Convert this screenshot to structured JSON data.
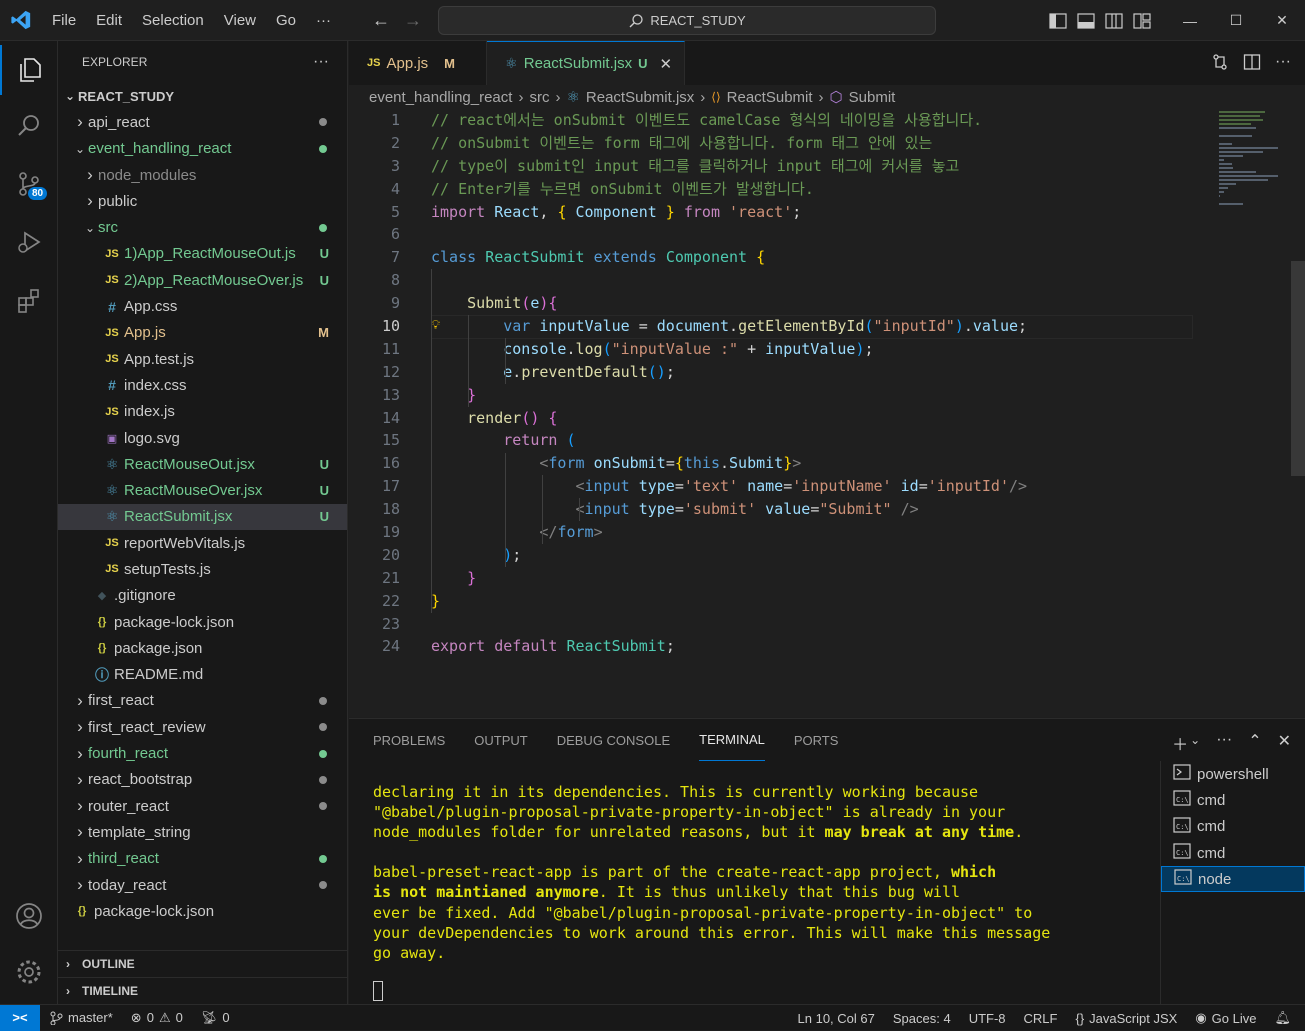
{
  "menu": [
    "File",
    "Edit",
    "Selection",
    "View",
    "Go",
    "···"
  ],
  "search": {
    "text": "REACT_STUDY"
  },
  "activity": {
    "badge": "80"
  },
  "explorer": {
    "title": "EXPLORER",
    "root": "REACT_STUDY",
    "rows": [
      {
        "label": "api_react",
        "type": "folder",
        "indent": 1,
        "open": false,
        "color": "#cccccc",
        "dot": "#8b8b8b"
      },
      {
        "label": "event_handling_react",
        "type": "folder",
        "indent": 1,
        "open": true,
        "color": "#73c991",
        "dot": "#73c991"
      },
      {
        "label": "node_modules",
        "type": "folder",
        "indent": 2,
        "open": false,
        "color": "#8b8b8b"
      },
      {
        "label": "public",
        "type": "folder",
        "indent": 2,
        "open": false,
        "color": "#cccccc"
      },
      {
        "label": "src",
        "type": "folder",
        "indent": 2,
        "open": true,
        "color": "#73c991",
        "dot": "#73c991"
      },
      {
        "label": "1)App_ReactMouseOut.js",
        "type": "js",
        "indent": 3,
        "color": "#73c991",
        "status": "U",
        "statusColor": "#73c991"
      },
      {
        "label": "2)App_ReactMouseOver.js",
        "type": "js",
        "indent": 3,
        "color": "#73c991",
        "status": "U",
        "statusColor": "#73c991"
      },
      {
        "label": "App.css",
        "type": "css",
        "indent": 3,
        "color": "#cccccc"
      },
      {
        "label": "App.js",
        "type": "js",
        "indent": 3,
        "color": "#e2c08d",
        "status": "M",
        "statusColor": "#e2c08d"
      },
      {
        "label": "App.test.js",
        "type": "js",
        "indent": 3,
        "color": "#cccccc"
      },
      {
        "label": "index.css",
        "type": "css",
        "indent": 3,
        "color": "#cccccc"
      },
      {
        "label": "index.js",
        "type": "js",
        "indent": 3,
        "color": "#cccccc"
      },
      {
        "label": "logo.svg",
        "type": "svg",
        "indent": 3,
        "color": "#cccccc"
      },
      {
        "label": "ReactMouseOut.jsx",
        "type": "jsx",
        "indent": 3,
        "color": "#73c991",
        "status": "U",
        "statusColor": "#73c991"
      },
      {
        "label": "ReactMouseOver.jsx",
        "type": "jsx",
        "indent": 3,
        "color": "#73c991",
        "status": "U",
        "statusColor": "#73c991"
      },
      {
        "label": "ReactSubmit.jsx",
        "type": "jsx",
        "indent": 3,
        "color": "#73c991",
        "status": "U",
        "statusColor": "#73c991",
        "selected": true
      },
      {
        "label": "reportWebVitals.js",
        "type": "js",
        "indent": 3,
        "color": "#cccccc"
      },
      {
        "label": "setupTests.js",
        "type": "js",
        "indent": 3,
        "color": "#cccccc"
      },
      {
        "label": ".gitignore",
        "type": "git",
        "indent": 2,
        "color": "#cccccc"
      },
      {
        "label": "package-lock.json",
        "type": "json",
        "indent": 2,
        "color": "#cccccc"
      },
      {
        "label": "package.json",
        "type": "json",
        "indent": 2,
        "color": "#cccccc"
      },
      {
        "label": "README.md",
        "type": "info",
        "indent": 2,
        "color": "#cccccc"
      },
      {
        "label": "first_react",
        "type": "folder",
        "indent": 1,
        "open": false,
        "color": "#cccccc",
        "dot": "#8b8b8b"
      },
      {
        "label": "first_react_review",
        "type": "folder",
        "indent": 1,
        "open": false,
        "color": "#cccccc",
        "dot": "#8b8b8b"
      },
      {
        "label": "fourth_react",
        "type": "folder",
        "indent": 1,
        "open": false,
        "color": "#73c991",
        "dot": "#73c991"
      },
      {
        "label": "react_bootstrap",
        "type": "folder",
        "indent": 1,
        "open": false,
        "color": "#cccccc",
        "dot": "#8b8b8b"
      },
      {
        "label": "router_react",
        "type": "folder",
        "indent": 1,
        "open": false,
        "color": "#cccccc",
        "dot": "#8b8b8b"
      },
      {
        "label": "template_string",
        "type": "folder",
        "indent": 1,
        "open": false,
        "color": "#cccccc"
      },
      {
        "label": "third_react",
        "type": "folder",
        "indent": 1,
        "open": false,
        "color": "#73c991",
        "dot": "#73c991"
      },
      {
        "label": "today_react",
        "type": "folder",
        "indent": 1,
        "open": false,
        "color": "#cccccc",
        "dot": "#8b8b8b"
      },
      {
        "label": "package-lock.json",
        "type": "json",
        "indent": 0,
        "color": "#cccccc"
      }
    ],
    "outline": "OUTLINE",
    "timeline": "TIMELINE"
  },
  "tabs": [
    {
      "icon": "JS",
      "label": "App.js",
      "status": "M",
      "active": false
    },
    {
      "icon": "⚛",
      "label": "ReactSubmit.jsx",
      "status": "U",
      "active": true
    }
  ],
  "breadcrumb": [
    "event_handling_react",
    "src",
    "ReactSubmit.jsx",
    "ReactSubmit",
    "Submit"
  ],
  "code": [
    [
      [
        "cm",
        "// react에서는 onSubmit 이벤트도 camelCase 형식의 네이밍을 사용합니다."
      ]
    ],
    [
      [
        "cm",
        "// onSubmit 이벤트는 form 태그에 사용합니다. form 태그 안에 있는"
      ]
    ],
    [
      [
        "cm",
        "// type이 submit인 input 태그를 클릭하거나 input 태그에 커서를 놓고"
      ]
    ],
    [
      [
        "cm",
        "// Enter키를 누르면 onSubmit 이벤트가 발생합니다."
      ]
    ],
    [
      [
        "kw2",
        "import "
      ],
      [
        "var",
        "React"
      ],
      [
        "pl",
        ", "
      ],
      [
        "br1",
        "{ "
      ],
      [
        "var",
        "Component"
      ],
      [
        "br1",
        " }"
      ],
      [
        "kw2",
        " from "
      ],
      [
        "str",
        "'react'"
      ],
      [
        "pl",
        ";"
      ]
    ],
    [],
    [
      [
        "kw",
        "class "
      ],
      [
        "cls",
        "ReactSubmit "
      ],
      [
        "kw",
        "extends "
      ],
      [
        "cls",
        "Component "
      ],
      [
        "br1",
        "{"
      ]
    ],
    [],
    [
      [
        "pl",
        "    "
      ],
      [
        "fn",
        "Submit"
      ],
      [
        "br2",
        "("
      ],
      [
        "var",
        "e"
      ],
      [
        "br2",
        ")"
      ],
      [
        "br2",
        "{"
      ]
    ],
    [
      [
        "pl",
        "        "
      ],
      [
        "kw",
        "var "
      ],
      [
        "var",
        "inputValue "
      ],
      [
        "pl",
        "= "
      ],
      [
        "var",
        "document"
      ],
      [
        "pl",
        "."
      ],
      [
        "fn",
        "getElementById"
      ],
      [
        "br3",
        "("
      ],
      [
        "str",
        "\"inputId\""
      ],
      [
        "br3",
        ")"
      ],
      [
        "pl",
        "."
      ],
      [
        "var",
        "value"
      ],
      [
        "pl",
        ";"
      ]
    ],
    [
      [
        "pl",
        "        "
      ],
      [
        "var",
        "console"
      ],
      [
        "pl",
        "."
      ],
      [
        "fn",
        "log"
      ],
      [
        "br3",
        "("
      ],
      [
        "str",
        "\"inputValue :\""
      ],
      [
        "pl",
        " + "
      ],
      [
        "var",
        "inputValue"
      ],
      [
        "br3",
        ")"
      ],
      [
        "pl",
        ";"
      ]
    ],
    [
      [
        "pl",
        "        "
      ],
      [
        "var",
        "e"
      ],
      [
        "pl",
        "."
      ],
      [
        "fn",
        "preventDefault"
      ],
      [
        "br3",
        "()"
      ],
      [
        "pl",
        ";"
      ]
    ],
    [
      [
        "pl",
        "    "
      ],
      [
        "br2",
        "}"
      ]
    ],
    [
      [
        "pl",
        "    "
      ],
      [
        "fn",
        "render"
      ],
      [
        "br2",
        "()"
      ],
      [
        "pl",
        " "
      ],
      [
        "br2",
        "{"
      ]
    ],
    [
      [
        "pl",
        "        "
      ],
      [
        "kw2",
        "return "
      ],
      [
        "br3",
        "("
      ]
    ],
    [
      [
        "pl",
        "            "
      ],
      [
        "tagb",
        "<"
      ],
      [
        "tag",
        "form "
      ],
      [
        "var",
        "onSubmit"
      ],
      [
        "pl",
        "="
      ],
      [
        "br1",
        "{"
      ],
      [
        "kw",
        "this"
      ],
      [
        "pl",
        "."
      ],
      [
        "var",
        "Submit"
      ],
      [
        "br1",
        "}"
      ],
      [
        "tagb",
        ">"
      ]
    ],
    [
      [
        "pl",
        "                "
      ],
      [
        "tagb",
        "<"
      ],
      [
        "tag",
        "input "
      ],
      [
        "var",
        "type"
      ],
      [
        "pl",
        "="
      ],
      [
        "str",
        "'text' "
      ],
      [
        "var",
        "name"
      ],
      [
        "pl",
        "="
      ],
      [
        "str",
        "'inputName' "
      ],
      [
        "var",
        "id"
      ],
      [
        "pl",
        "="
      ],
      [
        "str",
        "'inputId'"
      ],
      [
        "tagb",
        "/>"
      ]
    ],
    [
      [
        "pl",
        "                "
      ],
      [
        "tagb",
        "<"
      ],
      [
        "tag",
        "input "
      ],
      [
        "var",
        "type"
      ],
      [
        "pl",
        "="
      ],
      [
        "str",
        "'submit' "
      ],
      [
        "var",
        "value"
      ],
      [
        "pl",
        "="
      ],
      [
        "str",
        "\"Submit\" "
      ],
      [
        "tagb",
        "/>"
      ]
    ],
    [
      [
        "pl",
        "            "
      ],
      [
        "tagb",
        "</"
      ],
      [
        "tag",
        "form"
      ],
      [
        "tagb",
        ">"
      ]
    ],
    [
      [
        "pl",
        "        "
      ],
      [
        "br3",
        ")"
      ],
      [
        "pl",
        ";"
      ]
    ],
    [
      [
        "pl",
        "    "
      ],
      [
        "br2",
        "}"
      ]
    ],
    [
      [
        "br1",
        "}"
      ]
    ],
    [],
    [
      [
        "kw2",
        "export "
      ],
      [
        "kw2",
        "default "
      ],
      [
        "cls",
        "ReactSubmit"
      ],
      [
        "pl",
        ";"
      ]
    ]
  ],
  "current_line": 10,
  "panel": {
    "tabs": [
      "PROBLEMS",
      "OUTPUT",
      "DEBUG CONSOLE",
      "TERMINAL",
      "PORTS"
    ],
    "active": "TERMINAL",
    "terminal": [
      [
        [
          "n",
          "declaring it in its dependencies. This is currently working because"
        ]
      ],
      [
        [
          "n",
          "\"@babel/plugin-proposal-private-property-in-object\" is already in your"
        ]
      ],
      [
        [
          "n",
          "node_modules folder for unrelated reasons, but it "
        ],
        [
          "b",
          "may break at any time"
        ],
        [
          "n",
          "."
        ]
      ],
      [
        [
          "n",
          ""
        ]
      ],
      [
        [
          "n",
          "babel-preset-react-app is part of the create-react-app project, "
        ],
        [
          "b",
          "which"
        ]
      ],
      [
        [
          "b",
          "is not maintianed anymore"
        ],
        [
          "n",
          ". It is thus unlikely that this bug will"
        ]
      ],
      [
        [
          "n",
          "ever be fixed. Add \"@babel/plugin-proposal-private-property-in-object\" to"
        ]
      ],
      [
        [
          "n",
          "your devDependencies to work around this error. This will make this message"
        ]
      ],
      [
        [
          "n",
          "go away."
        ]
      ]
    ],
    "terminals": [
      {
        "icon": "ps",
        "label": "powershell"
      },
      {
        "icon": "cmd",
        "label": "cmd"
      },
      {
        "icon": "cmd",
        "label": "cmd"
      },
      {
        "icon": "cmd",
        "label": "cmd"
      },
      {
        "icon": "cmd",
        "label": "node",
        "selected": true
      }
    ]
  },
  "status": {
    "branch": "master*",
    "errors": "0",
    "warnings": "0",
    "ports": "0",
    "position": "Ln 10, Col 67",
    "spaces": "Spaces: 4",
    "encoding": "UTF-8",
    "eol": "CRLF",
    "language": "JavaScript JSX",
    "golive": "Go Live"
  }
}
